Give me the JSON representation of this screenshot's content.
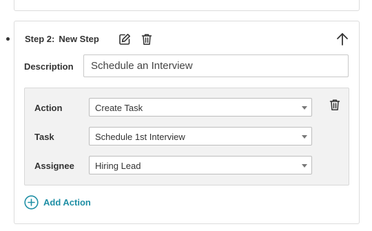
{
  "step": {
    "number_label": "Step 2:",
    "name": "New Step",
    "icons": {
      "edit": "edit-icon",
      "delete": "trash-icon",
      "collapse": "arrow-up-icon"
    }
  },
  "description": {
    "label": "Description",
    "value": "Schedule an Interview"
  },
  "action_block": {
    "rows": [
      {
        "label": "Action",
        "value": "Create Task"
      },
      {
        "label": "Task",
        "value": "Schedule 1st Interview"
      },
      {
        "label": "Assignee",
        "value": "Hiring Lead"
      }
    ],
    "delete_icon": "trash-icon"
  },
  "add_action": {
    "label": "Add Action",
    "icon": "plus-circle-icon"
  },
  "colors": {
    "accent": "#1f8fa5",
    "border": "#dcdcdc",
    "action_bg": "#f2f2f2",
    "text": "#333333"
  }
}
